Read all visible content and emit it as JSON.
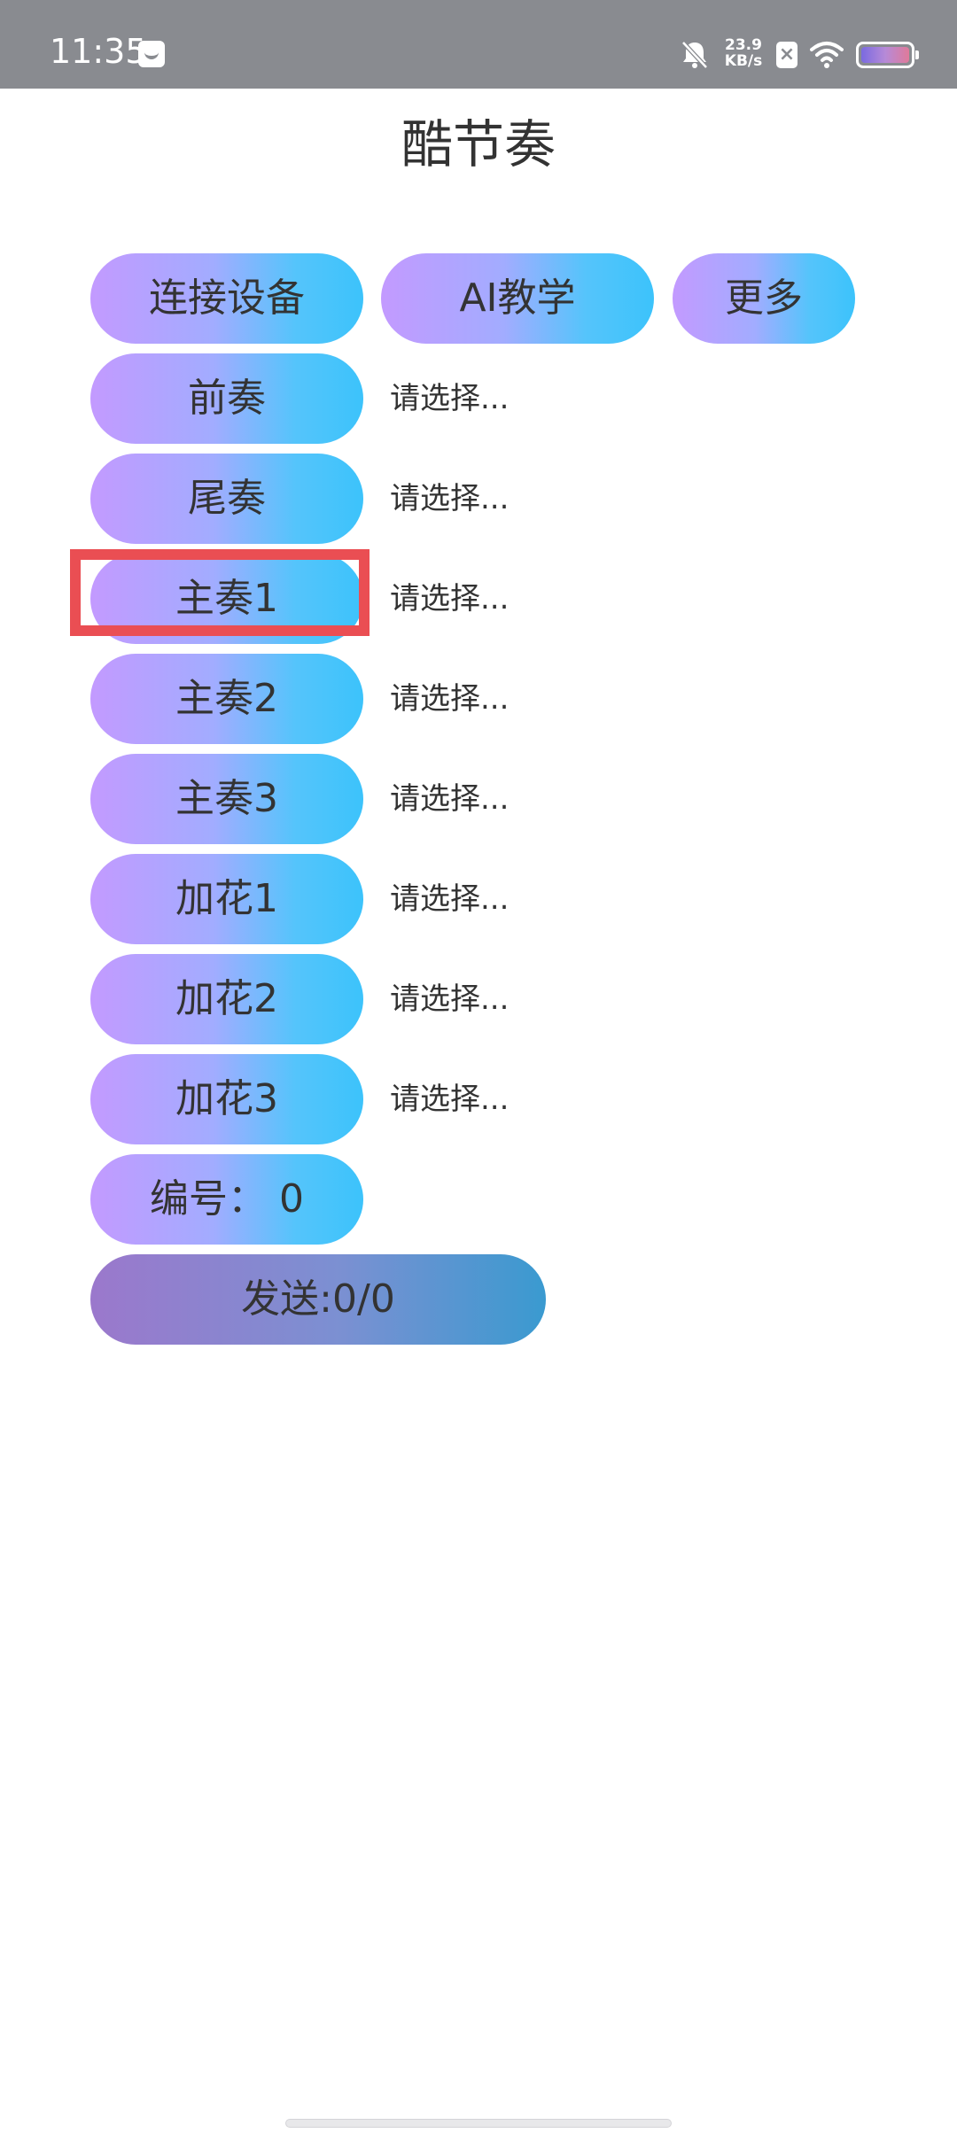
{
  "status_bar": {
    "time": "11:35",
    "net_speed_value": "23.9",
    "net_speed_unit": "KB/s",
    "icons": [
      "message-icon",
      "mute-bell-icon",
      "sim-x-icon",
      "wifi-icon",
      "battery-icon"
    ]
  },
  "app": {
    "title": "酷节奏"
  },
  "top_buttons": {
    "connect": "连接设备",
    "ai_teach": "AI教学",
    "more": "更多"
  },
  "sections": [
    {
      "label": "前奏",
      "value": "请选择..."
    },
    {
      "label": "尾奏",
      "value": "请选择..."
    },
    {
      "label": "主奏1",
      "value": "请选择..."
    },
    {
      "label": "主奏2",
      "value": "请选择..."
    },
    {
      "label": "主奏3",
      "value": "请选择..."
    },
    {
      "label": "加花1",
      "value": "请选择..."
    },
    {
      "label": "加花2",
      "value": "请选择..."
    },
    {
      "label": "加花3",
      "value": "请选择..."
    }
  ],
  "number_label": "编号：  0",
  "send_label": "发送:0/0",
  "colors": {
    "status_bar_bg": "#898b90",
    "button_gradient_start": "#c39aff",
    "button_gradient_end": "#3cc3fb",
    "highlight": "#ea4e53"
  }
}
